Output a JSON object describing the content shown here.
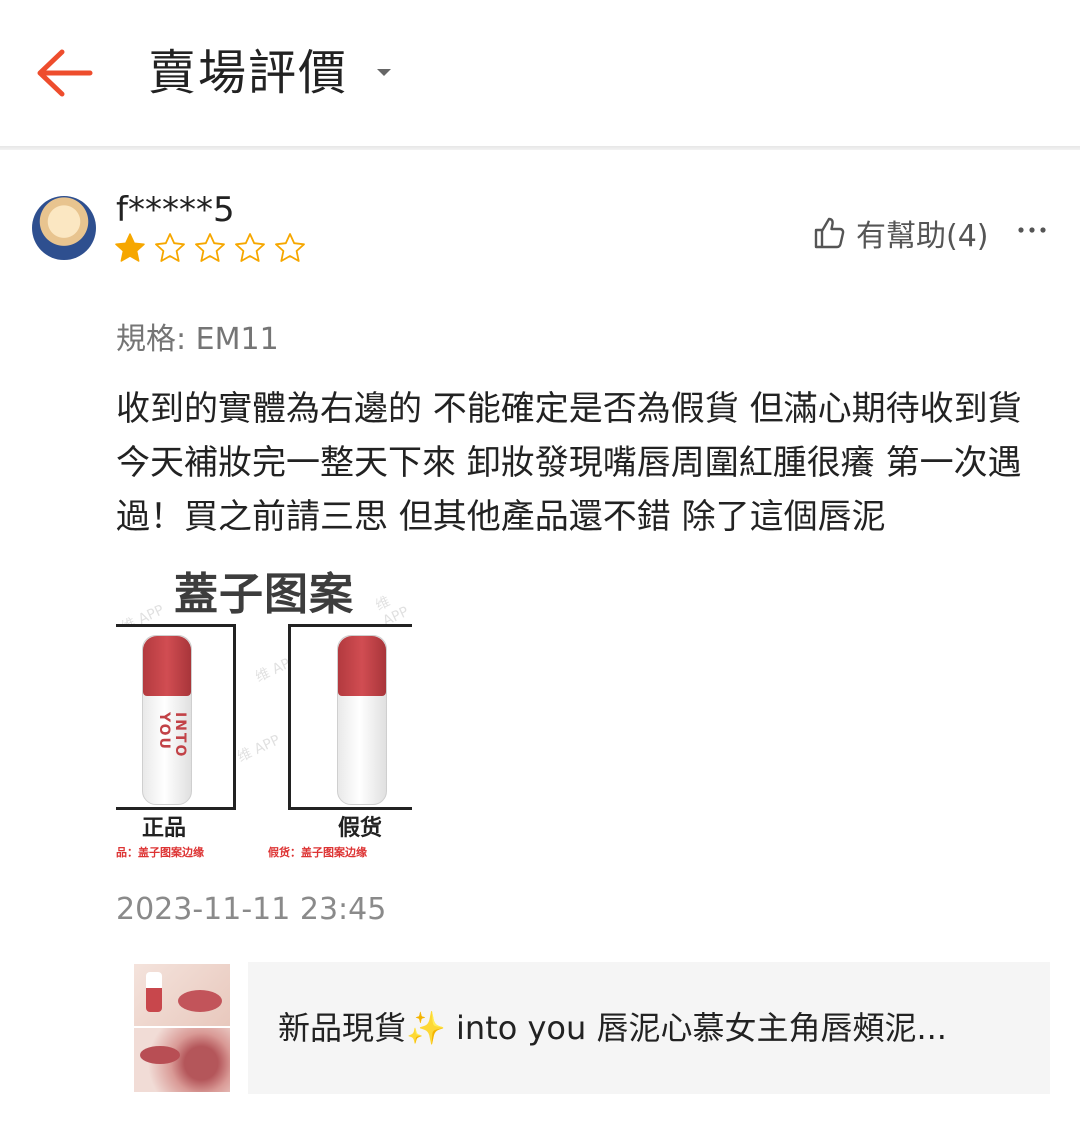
{
  "header": {
    "title": "賣場評價",
    "icons": {
      "back": "arrow-left-icon",
      "dropdown": "caret-down-icon"
    },
    "accent_color": "#ee4d2d"
  },
  "review": {
    "username": "f*****5",
    "rating": 1,
    "rating_max": 5,
    "helpful_label": "有幫助(4)",
    "variation": "規格: EM11",
    "comment": "收到的實體為右邊的 不能確定是否為假貨 但滿心期待收到貨今天補妝完一整天下來 卸妝發現嘴唇周圍紅腫很癢 第一次遇過！買之前請三思 但其他產品還不錯 除了這個唇泥",
    "timestamp": "2023-11-11 23:45",
    "image": {
      "title": "蓋子图案",
      "left_label": "正品",
      "right_label": "假货",
      "left_note": "品：盖子图案边缘",
      "right_note": "假货：盖子图案边缘",
      "tube_brand": "INTO YOU",
      "watermark": "维 APP"
    },
    "colors": {
      "star_filled": "#f6a700",
      "star_empty": "#f6a700"
    }
  },
  "product": {
    "title": "新品現貨✨ into you 唇泥心慕女主角唇頰泥..."
  }
}
